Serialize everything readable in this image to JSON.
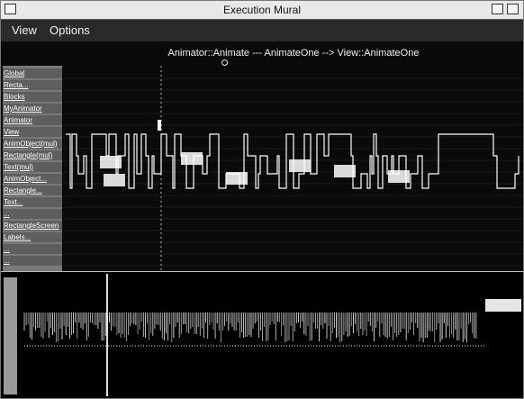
{
  "window": {
    "title": "Execution Mural"
  },
  "menu": {
    "view": "View",
    "options": "Options"
  },
  "mural": {
    "caption": "Animator::Animate --- AnimateOne --> View::AnimateOne",
    "class_labels": [
      "Global",
      "Recta...",
      "Blocks",
      "MyAnimator",
      "Animator",
      "View",
      "AnimObject(mul)",
      "Rectangle(mul)",
      "Text(mul)",
      "AnimObject...",
      "Rectangle...",
      "Text...",
      "...",
      "RectangleScreen",
      "Labels...",
      "...",
      "..."
    ]
  },
  "colors": {
    "background": "#0a0a0a",
    "trace": "#ffffff",
    "label_panel": "#7a7a7a"
  }
}
